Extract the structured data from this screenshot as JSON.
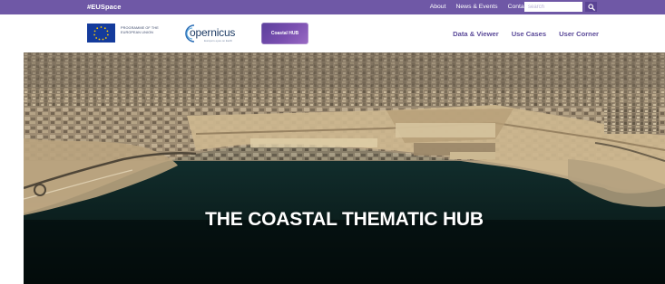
{
  "topbar": {
    "hashtag": "#EUSpace",
    "links": [
      "About",
      "News & Events",
      "Contact"
    ],
    "search_placeholder": "search",
    "search_icon": "magnifier-icon"
  },
  "header": {
    "eu_programme_text_line1": "PROGRAMME OF THE",
    "eu_programme_text_line2": "EUROPEAN UNION",
    "copernicus_wordmark": "opernicus",
    "copernicus_tagline": "Europe's eyes on Earth",
    "badge_label": "Coastal HUB",
    "nav": [
      "Data & Viewer",
      "Use Cases",
      "User Corner"
    ]
  },
  "hero": {
    "title": "THE COASTAL THEMATIC HUB"
  },
  "colors": {
    "brand_purple": "#6f58a6",
    "nav_text": "#5b4a99",
    "eu_blue": "#143b9c",
    "eu_star_yellow": "#ffcc00"
  }
}
